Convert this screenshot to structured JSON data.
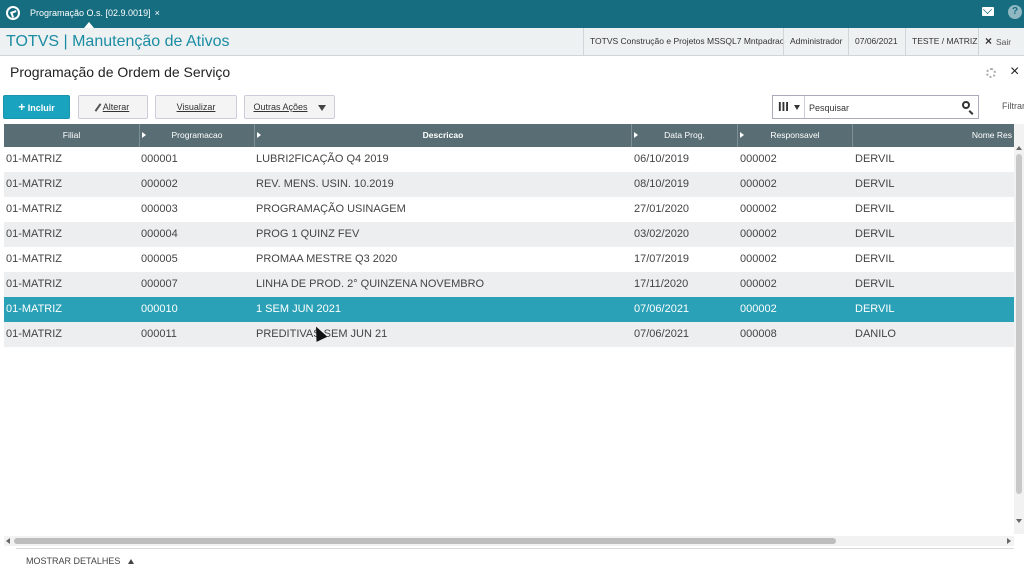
{
  "topbar": {
    "tab_label": "Programação O.s. [02.9.0019]",
    "tab_close": "×",
    "help_label": "?"
  },
  "appbar": {
    "title": "TOTVS | Manutenção de Ativos",
    "company": "TOTVS Construção e Projetos MSSQL7 Mntpadrao",
    "user": "Administrador",
    "date": "07/06/2021",
    "branch": "TESTE / MATRIZ",
    "exit_label": "Sair",
    "exit_icon": "×"
  },
  "page": {
    "title": "Programação de Ordem de Serviço",
    "close_glyph": "×"
  },
  "toolbar": {
    "include_label": "Incluir",
    "include_plus": "+",
    "edit_label": "Alterar",
    "view_label": "Visualizar",
    "other_label": "Outras Ações",
    "search_placeholder": "Pesquisar",
    "columns_glyph": "III",
    "filter_label": "Filtrar"
  },
  "table": {
    "columns": [
      "Filial",
      "Programacao",
      "Descricao",
      "Data Prog.",
      "Responsavel",
      "Nome Res"
    ],
    "rows": [
      {
        "filial": "01-MATRIZ",
        "programacao": "000001",
        "descricao": "LUBRI2FICAÇÃO Q4 2019",
        "data": "06/10/2019",
        "responsavel": "000002",
        "nome": "DERVIL"
      },
      {
        "filial": "01-MATRIZ",
        "programacao": "000002",
        "descricao": "REV. MENS. USIN. 10.2019",
        "data": "08/10/2019",
        "responsavel": "000002",
        "nome": "DERVIL"
      },
      {
        "filial": "01-MATRIZ",
        "programacao": "000003",
        "descricao": "PROGRAMAÇÃO USINAGEM",
        "data": "27/01/2020",
        "responsavel": "000002",
        "nome": "DERVIL"
      },
      {
        "filial": "01-MATRIZ",
        "programacao": "000004",
        "descricao": "PROG 1 QUINZ FEV",
        "data": "03/02/2020",
        "responsavel": "000002",
        "nome": "DERVIL"
      },
      {
        "filial": "01-MATRIZ",
        "programacao": "000005",
        "descricao": "PROMAA MESTRE Q3 2020",
        "data": "17/07/2019",
        "responsavel": "000002",
        "nome": "DERVIL"
      },
      {
        "filial": "01-MATRIZ",
        "programacao": "000007",
        "descricao": "LINHA DE PROD. 2° QUINZENA NOVEMBRO",
        "data": "17/11/2020",
        "responsavel": "000002",
        "nome": "DERVIL"
      },
      {
        "filial": "01-MATRIZ",
        "programacao": "000010",
        "descricao": "1 SEM JUN 2021",
        "data": "07/06/2021",
        "responsavel": "000002",
        "nome": "DERVIL"
      },
      {
        "filial": "01-MATRIZ",
        "programacao": "000011",
        "descricao": "PREDITIVAS SEM JUN 21",
        "data": "07/06/2021",
        "responsavel": "000008",
        "nome": "DANILO"
      }
    ],
    "selected_index": 6
  },
  "footer": {
    "details_label": "MOSTRAR DETALHES"
  },
  "colors": {
    "topbar": "#176d80",
    "title_accent": "#1a8ca3",
    "primary_button": "#1aa3bf",
    "header_row": "#596e74",
    "selected_row": "#2aa1b6"
  }
}
